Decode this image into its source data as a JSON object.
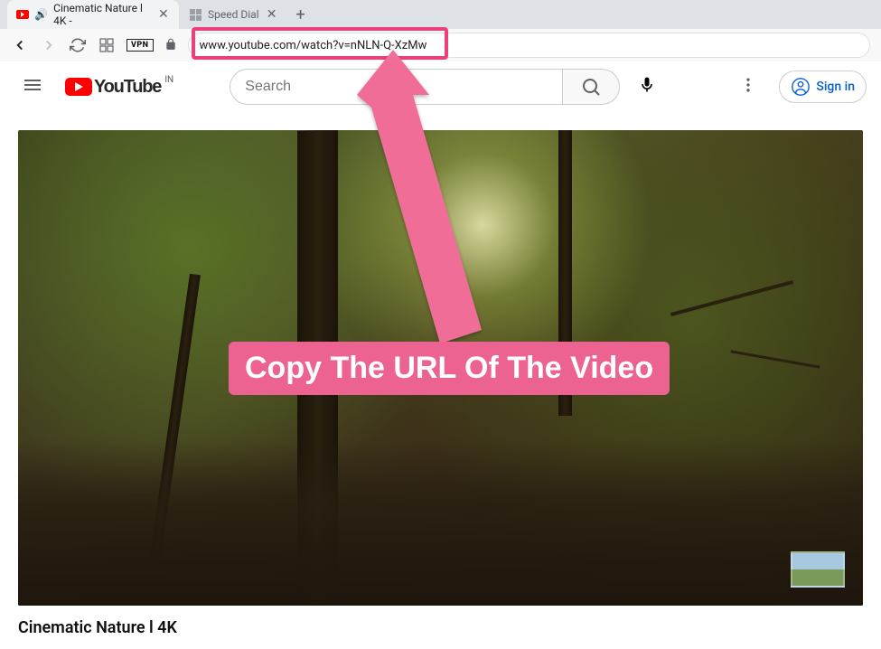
{
  "browser": {
    "tabs": [
      {
        "title": "Cinematic Nature l 4K - "
      },
      {
        "title": "Speed Dial"
      }
    ],
    "url": "www.youtube.com/watch?v=nNLN-Q-XzMw",
    "vpn": "VPN"
  },
  "youtube": {
    "country": "IN",
    "logo_text": "YouTube",
    "search_placeholder": "Search",
    "signin": "Sign in"
  },
  "annotation": {
    "text": "Copy The URL Of The Video"
  },
  "video": {
    "title": "Cinematic Nature l 4K"
  }
}
